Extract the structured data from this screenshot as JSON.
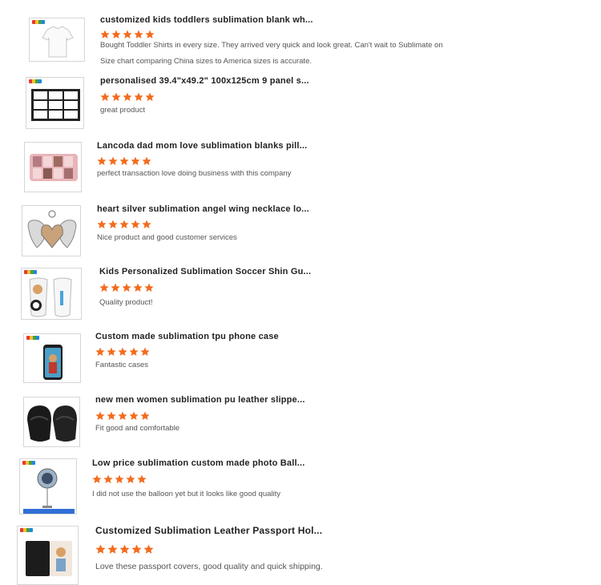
{
  "colors": {
    "star": "#f26c1e",
    "title": "#222222",
    "comment": "#555555"
  },
  "reviews": [
    {
      "title": "customized kids toddlers sublimation blank wh...",
      "stars": 5,
      "comment": [
        "Bought Toddler Shirts in every size. They arrived very quick and look great. Can't wait to Sublimate on",
        "Size chart comparing China sizes to America sizes is accurate."
      ]
    },
    {
      "title": "personalised 39.4\"x49.2\" 100x125cm 9 panel s...",
      "stars": 5,
      "comment": [
        "great product"
      ]
    },
    {
      "title": "Lancoda dad mom love sublimation blanks pill...",
      "stars": 5,
      "comment": [
        "perfect transaction love doing business with this company"
      ]
    },
    {
      "title": "heart silver sublimation angel wing necklace lo...",
      "stars": 5,
      "comment": [
        "Nice product and good customer services"
      ]
    },
    {
      "title": "Kids Personalized Sublimation Soccer Shin Gu...",
      "stars": 5,
      "comment": [
        "Quality product!"
      ]
    },
    {
      "title": "Custom made sublimation tpu phone case",
      "stars": 5,
      "comment": [
        "Fantastic cases"
      ]
    },
    {
      "title": "new men women sublimation pu leather slippe...",
      "stars": 5,
      "comment": [
        "Fit good and comfortable"
      ]
    },
    {
      "title": "Low price sublimation custom made photo Ball...",
      "stars": 5,
      "comment": [
        "I did not use the balloon yet but it looks like good quality"
      ]
    },
    {
      "title": "Customized Sublimation Leather Passport Hol...",
      "stars": 5,
      "comment": [
        "Love these passport covers, good quality and quick shipping."
      ]
    }
  ]
}
